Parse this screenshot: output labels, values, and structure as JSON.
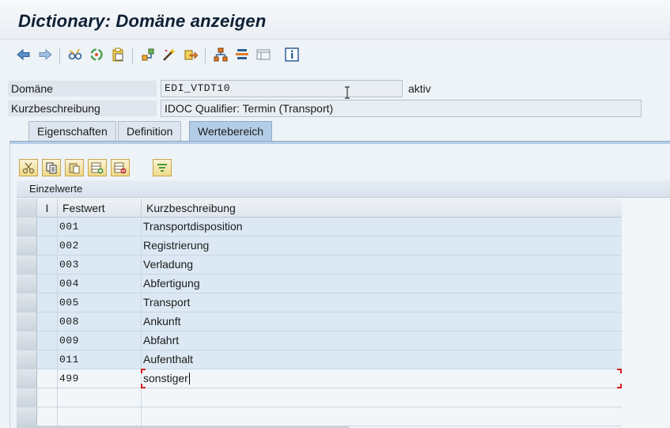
{
  "window": {
    "title": "Dictionary: Domäne anzeigen"
  },
  "toolbar": {
    "buttons": [
      {
        "name": "back-icon"
      },
      {
        "name": "forward-icon"
      },
      {
        "name": "glasses-icon"
      },
      {
        "name": "activate-icon"
      },
      {
        "name": "clipboard-icon"
      },
      {
        "name": "where-used-icon"
      },
      {
        "name": "magic-wand-icon"
      },
      {
        "name": "transport-icon"
      },
      {
        "name": "hierarchy-icon"
      },
      {
        "name": "stack-icon"
      },
      {
        "name": "layout-icon"
      },
      {
        "name": "info-icon"
      }
    ]
  },
  "header": {
    "domain_label": "Domäne",
    "domain_value": "EDI_VTDT10",
    "status": "aktiv",
    "short_desc_label": "Kurzbeschreibung",
    "short_desc_value": "IDOC Qualifier: Termin (Transport)"
  },
  "tabs": [
    {
      "label": "Eigenschaften",
      "active": false
    },
    {
      "label": "Definition",
      "active": false
    },
    {
      "label": "Wertebereich",
      "active": true
    }
  ],
  "table": {
    "section_title": "Einzelwerte",
    "columns": [
      "I",
      "Festwert",
      "Kurzbeschreibung"
    ],
    "rows": [
      {
        "festwert": "001",
        "kurz": "Transportdisposition"
      },
      {
        "festwert": "002",
        "kurz": "Registrierung"
      },
      {
        "festwert": "003",
        "kurz": "Verladung"
      },
      {
        "festwert": "004",
        "kurz": "Abfertigung"
      },
      {
        "festwert": "005",
        "kurz": "Transport"
      },
      {
        "festwert": "008",
        "kurz": "Ankunft"
      },
      {
        "festwert": "009",
        "kurz": "Abfahrt"
      },
      {
        "festwert": "011",
        "kurz": "Aufenthalt"
      },
      {
        "festwert": "499",
        "kurz": "sonstiger"
      }
    ]
  },
  "colors": {
    "accent": "#b4cde6",
    "row": "#dce9f4",
    "focus_marker": "#d42020"
  }
}
